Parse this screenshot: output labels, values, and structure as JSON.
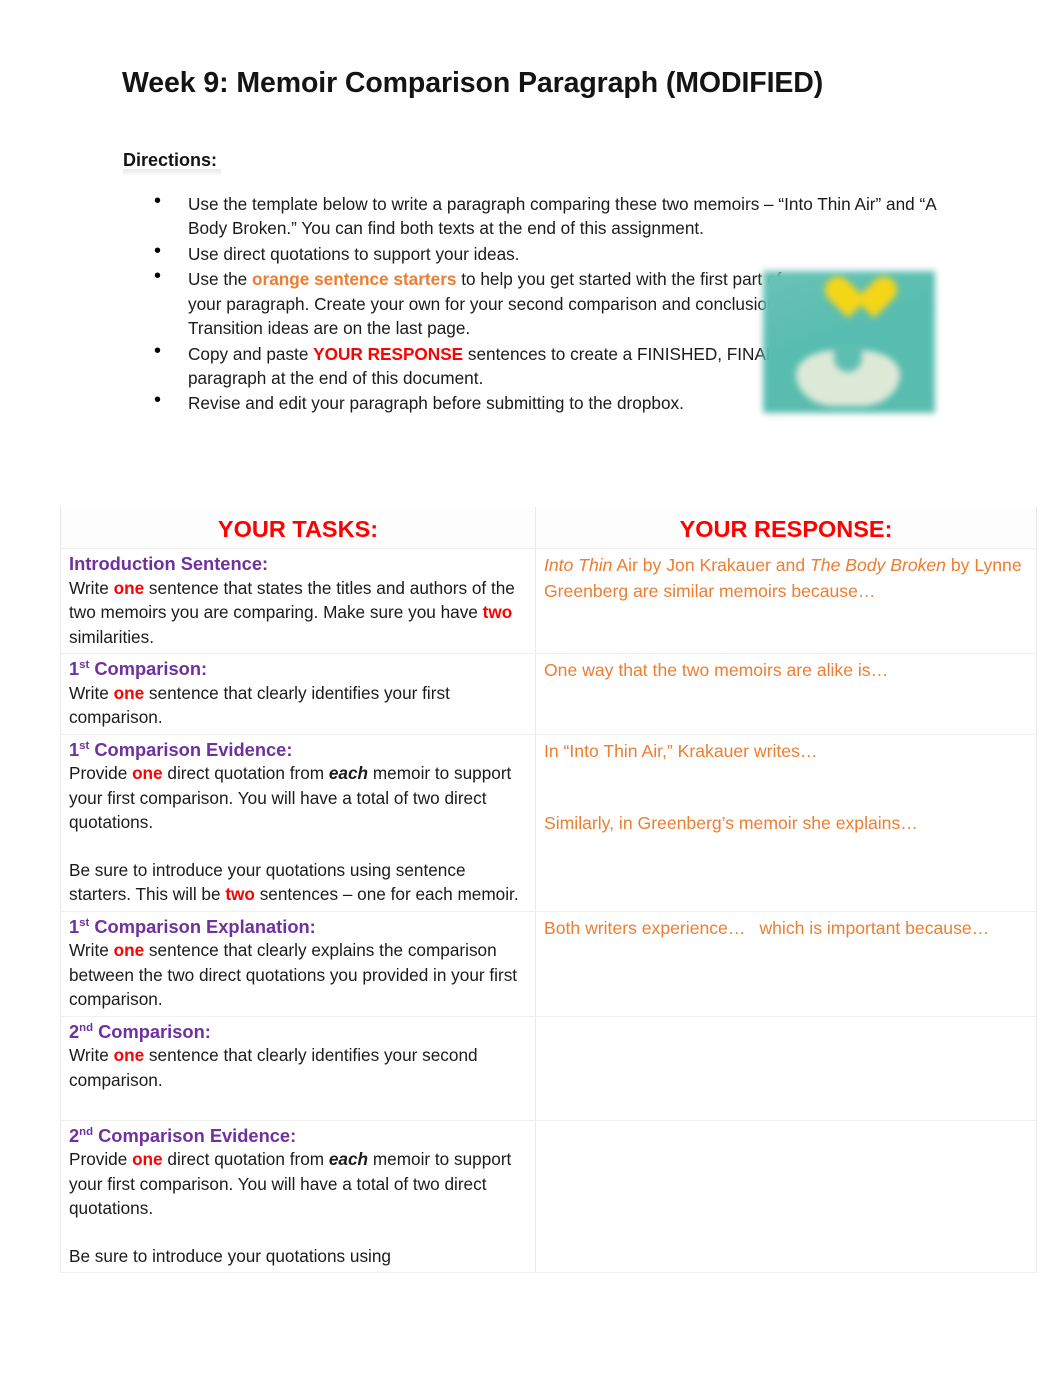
{
  "document": {
    "title": "Week 9: Memoir Comparison Paragraph (MODIFIED)",
    "directions_label": "Directions:"
  },
  "colors": {
    "red": "#FF0000",
    "orange": "#ED7D31",
    "purple": "#7030A0",
    "teal": "#59BCAE",
    "yellow": "#F5D518"
  },
  "directions": {
    "bullets": [
      {
        "segments": [
          {
            "text": "Use the template below to write a paragraph comparing these two memoirs – “Into Thin Air” and “A Body Broken.” You can find both texts at the end of this assignment.",
            "style": "plain"
          }
        ]
      },
      {
        "segments": [
          {
            "text": "Use direct quotations to support your ideas.",
            "style": "plain"
          }
        ]
      },
      {
        "narrow": true,
        "segments": [
          {
            "text": "Use the ",
            "style": "plain"
          },
          {
            "text": "orange sentence starters",
            "style": "orange-bold"
          },
          {
            "text": " to help you get started with the first part of your paragraph.  Create your own for your second comparison and conclusion.  Transition ideas are on the last page.",
            "style": "plain"
          }
        ]
      },
      {
        "narrow": true,
        "segments": [
          {
            "text": "Copy and paste ",
            "style": "plain"
          },
          {
            "text": "YOUR RESPONSE",
            "style": "red-bold"
          },
          {
            "text": " sentences to create a FINISHED, FINAL paragraph at the end of this document.",
            "style": "plain"
          }
        ]
      },
      {
        "segments": [
          {
            "text": "Revise and edit your paragraph before submitting to the dropbox.",
            "style": "plain"
          }
        ]
      }
    ]
  },
  "decorative_image": {
    "alt": "blurred teal image with yellow heart above cupped hands"
  },
  "table": {
    "headers": {
      "tasks": "YOUR TASKS:",
      "response": "YOUR RESPONSE:"
    },
    "rows": [
      {
        "task_heading_pre": "Introduction Sentence:",
        "task_heading_sup": "",
        "task_heading_post": "",
        "task_body_1": "Write ",
        "task_body_em1": "one",
        "task_body_2": " sentence that states the titles and authors of the two memoirs you are comparing. Make sure you have ",
        "task_body_em2": "two",
        "task_body_3": " similarities.",
        "response_parts": [
          {
            "text": "Into Thin",
            "style": "italic"
          },
          {
            "text": " Air by Jon Krakauer and ",
            "style": "plain"
          },
          {
            "text": "The Body Broken",
            "style": "italic"
          },
          {
            "text": " by Lynne Greenberg are similar memoirs because…",
            "style": "plain"
          }
        ]
      },
      {
        "task_heading_pre": "1",
        "task_heading_sup": "st",
        "task_heading_post": " Comparison:",
        "task_body_1": "Write ",
        "task_body_em1": "one",
        "task_body_2": " sentence that clearly identifies your first comparison.",
        "task_body_em2": "",
        "task_body_3": "",
        "response_parts": [
          {
            "text": "One way that the two memoirs are alike is…",
            "style": "plain"
          }
        ]
      },
      {
        "task_heading_pre": "1",
        "task_heading_sup": "st",
        "task_heading_post": " Comparison Evidence:",
        "task_body_1": "Provide ",
        "task_body_em1": "one",
        "task_body_2": " direct quotation from ",
        "task_body_bi": "each",
        "task_body_3": " memoir to support your first comparison. You will have a total of two direct quotations.",
        "task_body_4": "Be sure to introduce your quotations using sentence starters. This will be ",
        "task_body_em3": "two",
        "task_body_5": " sentences – one for each memoir.",
        "response_parts": [
          {
            "text": "In “Into Thin Air,” Krakauer writes…",
            "style": "plain"
          }
        ],
        "response_parts_2": [
          {
            "text": "Similarly, in Greenberg’s memoir she explains…",
            "style": "plain"
          }
        ]
      },
      {
        "task_heading_pre": "1",
        "task_heading_sup": "st",
        "task_heading_post": " Comparison Explanation:",
        "task_body_1": "Write ",
        "task_body_em1": "one",
        "task_body_2": " sentence that clearly explains the comparison between the two direct quotations you provided in your first comparison.",
        "task_body_em2": "",
        "task_body_3": "",
        "response_parts": [
          {
            "text": "Both writers experience…",
            "style": "plain"
          },
          {
            "text": "GAP",
            "style": "gap"
          },
          {
            "text": "which is important because…",
            "style": "plain"
          }
        ]
      },
      {
        "task_heading_pre": "2",
        "task_heading_sup": "nd",
        "task_heading_post": " Comparison:",
        "task_body_1": "Write ",
        "task_body_em1": "one",
        "task_body_2": " sentence that clearly identifies your second comparison.",
        "task_body_em2": "",
        "task_body_3": "",
        "response_parts": []
      },
      {
        "task_heading_pre": "2",
        "task_heading_sup": "nd",
        "task_heading_post": " Comparison Evidence:",
        "task_body_1": "Provide ",
        "task_body_em1": "one",
        "task_body_2": " direct quotation from ",
        "task_body_bi": "each",
        "task_body_3": " memoir to support your first comparison. You will have a total of two direct quotations.",
        "task_body_4": "Be sure to introduce your quotations using",
        "task_body_em3": "",
        "task_body_5": "",
        "response_parts": []
      }
    ]
  }
}
